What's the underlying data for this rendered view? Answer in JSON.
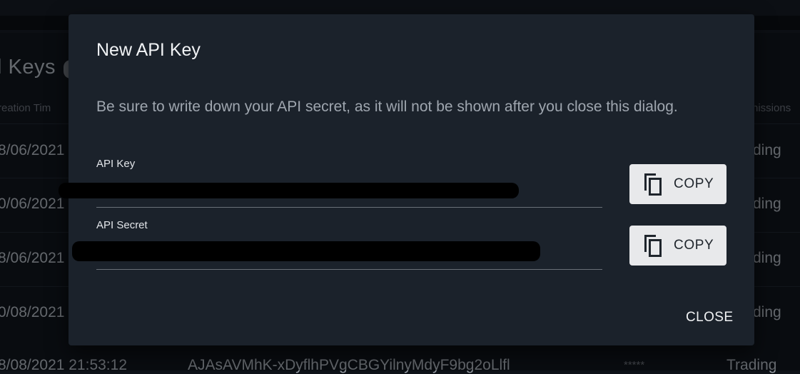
{
  "background": {
    "page_title": "l Keys",
    "columns": {
      "creation_time": "reation Tim",
      "permissions": "nissions"
    },
    "rows": [
      {
        "date": "8/06/2021",
        "permission": "ding"
      },
      {
        "date": "0/06/2021",
        "permission": "ding"
      },
      {
        "date": "8/06/2021",
        "permission": "ding"
      },
      {
        "date": "0/08/2021",
        "permission": "ding"
      },
      {
        "date": "8/08/2021  21:53:12",
        "key": "AJAsAVMhK-xDyflhPVgCBGYilnyMdyF9bg2oLlfl",
        "secret": "*****",
        "permission": "Trading"
      }
    ]
  },
  "dialog": {
    "title": "New API Key",
    "message": "Be sure to write down your API secret, as it will not be shown after you close this dialog.",
    "api_key": {
      "label": "API Key",
      "value": "",
      "copy_label": "COPY"
    },
    "api_secret": {
      "label": "API Secret",
      "value": "",
      "copy_label": "COPY"
    },
    "close_label": "CLOSE"
  },
  "icons": {
    "copy": "copy-icon"
  }
}
